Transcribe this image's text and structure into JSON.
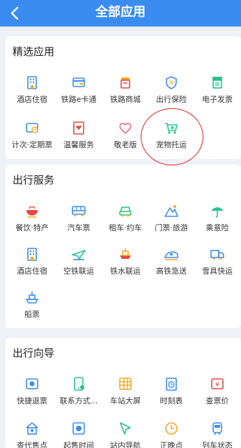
{
  "header": {
    "title": "全部应用",
    "back_icon": "chevron-left-icon"
  },
  "colors": {
    "primary": "#3a8cf0",
    "green": "#22c38a",
    "orange": "#f5a623",
    "red": "#e8473c",
    "pink": "#f06a8a",
    "annotation": "#e02020"
  },
  "sections": [
    {
      "title": "精选应用",
      "items": [
        {
          "label": "酒店住宿",
          "icon": "hotel-icon"
        },
        {
          "label": "铁路e卡通",
          "icon": "card-icon"
        },
        {
          "label": "铁路商城",
          "icon": "shop-icon"
        },
        {
          "label": "出行保险",
          "icon": "insurance-icon"
        },
        {
          "label": "电子发票",
          "icon": "invoice-icon"
        },
        {
          "label": "计次·定期票",
          "icon": "ticket-icon"
        },
        {
          "label": "温馨服务",
          "icon": "service-icon"
        },
        {
          "label": "敬老版",
          "icon": "heart-icon"
        },
        {
          "label": "宠物托运",
          "icon": "pet-cart-icon"
        }
      ]
    },
    {
      "title": "出行服务",
      "items": [
        {
          "label": "餐饮·特产",
          "icon": "food-icon"
        },
        {
          "label": "汽车票",
          "icon": "bus-icon"
        },
        {
          "label": "租车·约车",
          "icon": "car-icon"
        },
        {
          "label": "门票·旅游",
          "icon": "mountain-icon"
        },
        {
          "label": "乘意险",
          "icon": "umbrella-icon"
        },
        {
          "label": "酒店住宿",
          "icon": "hotel-icon"
        },
        {
          "label": "空铁联运",
          "icon": "plane-icon"
        },
        {
          "label": "铁水联运",
          "icon": "ship-icon"
        },
        {
          "label": "高铁急送",
          "icon": "train-icon"
        },
        {
          "label": "雪具快运",
          "icon": "truck-icon"
        },
        {
          "label": "船票",
          "icon": "boat-icon"
        }
      ]
    },
    {
      "title": "出行向导",
      "items": [
        {
          "label": "快捷退票",
          "icon": "refund-icon"
        },
        {
          "label": "联系方式...",
          "icon": "phone-icon"
        },
        {
          "label": "车站大屏",
          "icon": "screen-icon"
        },
        {
          "label": "时刻表",
          "icon": "timetable-icon"
        },
        {
          "label": "查票价",
          "icon": "price-icon"
        },
        {
          "label": "查代售点",
          "icon": "outlet-icon"
        },
        {
          "label": "起售时间",
          "icon": "clock-icon"
        },
        {
          "label": "站内导航",
          "icon": "navigation-icon"
        },
        {
          "label": "正晚点",
          "icon": "delay-icon"
        },
        {
          "label": "列车状态",
          "icon": "train-status-icon"
        }
      ]
    }
  ]
}
